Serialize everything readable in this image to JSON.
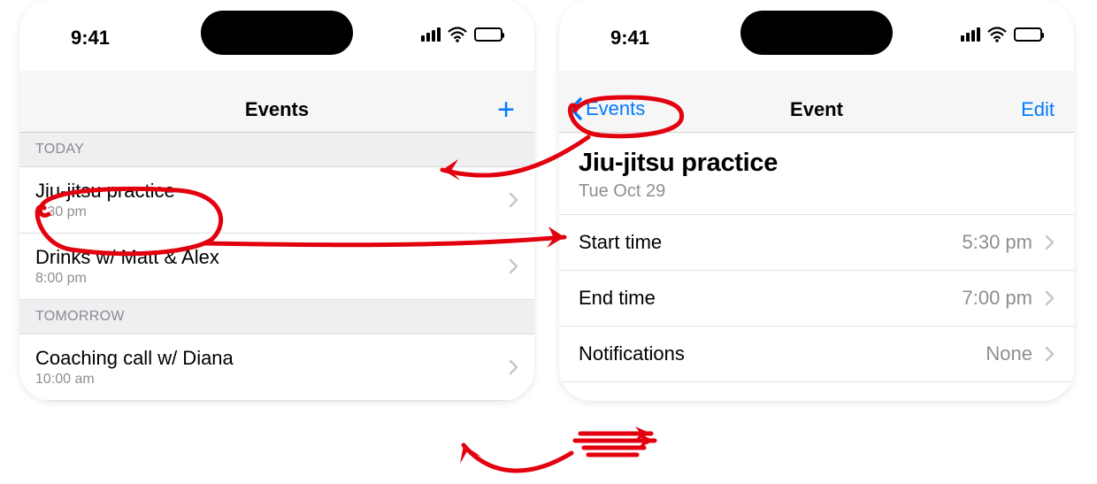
{
  "status": {
    "time": "9:41"
  },
  "left": {
    "nav": {
      "title": "Events",
      "add_icon": "+"
    },
    "sections": [
      {
        "header": "TODAY",
        "rows": [
          {
            "title": "Jiu-jitsu practice",
            "time": "5:30 pm"
          },
          {
            "title": "Drinks w/ Matt & Alex",
            "time": "8:00 pm"
          }
        ]
      },
      {
        "header": "TOMORROW",
        "rows": [
          {
            "title": "Coaching call w/ Diana",
            "time": "10:00 am"
          }
        ]
      }
    ]
  },
  "right": {
    "nav": {
      "back": "Events",
      "title": "Event",
      "edit": "Edit"
    },
    "detail": {
      "title": "Jiu-jitsu practice",
      "date": "Tue Oct 29"
    },
    "rows": [
      {
        "key": "Start time",
        "val": "5:30 pm"
      },
      {
        "key": "End time",
        "val": "7:00 pm"
      },
      {
        "key": "Notifications",
        "val": "None"
      }
    ]
  },
  "colors": {
    "accent": "#007aff",
    "annotation": "#e3000e"
  }
}
